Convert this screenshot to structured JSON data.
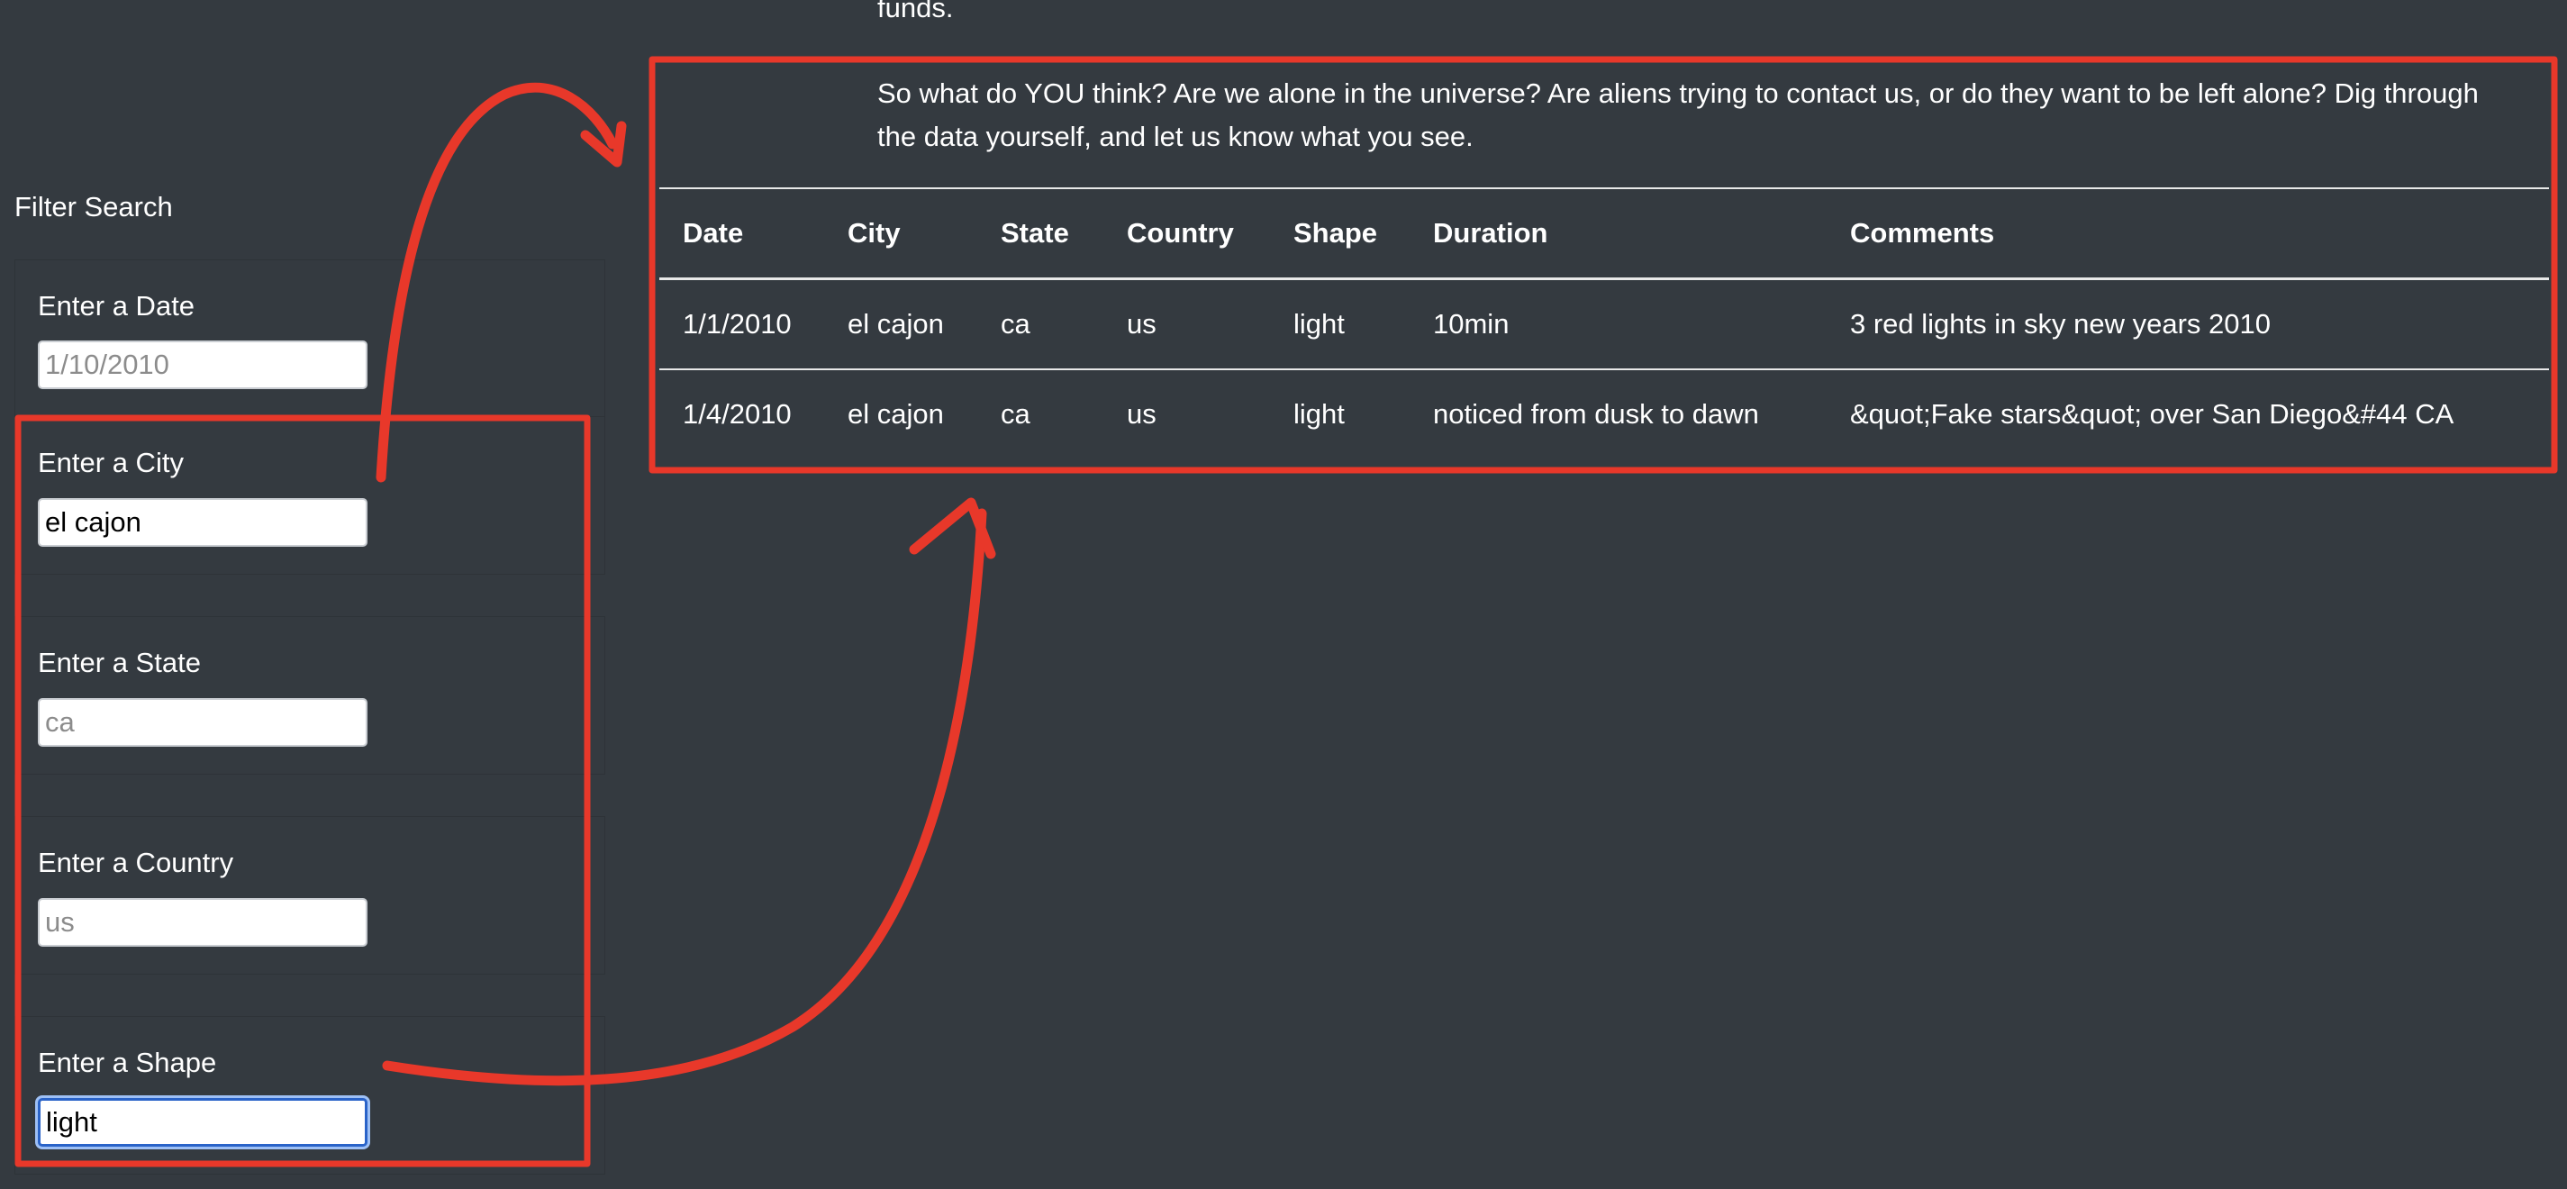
{
  "intro": {
    "tail": "funds.",
    "question": "So what do YOU think? Are we alone in the universe? Are aliens trying to contact us, or do they want to be left alone? Dig through the data yourself, and let us know what you see."
  },
  "filters": {
    "title": "Filter Search",
    "date": {
      "label": "Enter a Date",
      "placeholder": "1/10/2010",
      "value": ""
    },
    "city": {
      "label": "Enter a City",
      "placeholder": "",
      "value": "el cajon"
    },
    "state": {
      "label": "Enter a State",
      "placeholder": "ca",
      "value": ""
    },
    "country": {
      "label": "Enter a Country",
      "placeholder": "us",
      "value": ""
    },
    "shape": {
      "label": "Enter a Shape",
      "placeholder": "",
      "value": "light"
    }
  },
  "table": {
    "headers": [
      "Date",
      "City",
      "State",
      "Country",
      "Shape",
      "Duration",
      "Comments"
    ],
    "rows": [
      [
        "1/1/2010",
        "el cajon",
        "ca",
        "us",
        "light",
        "10min",
        "3 red lights in sky new years 2010"
      ],
      [
        "1/4/2010",
        "el cajon",
        "ca",
        "us",
        "light",
        "noticed from dusk to dawn",
        "&quot;Fake stars&quot; over San Diego&#44 CA"
      ]
    ]
  },
  "colors": {
    "background": "#343a40",
    "annotation": "#e8382a",
    "focus_ring": "#2a63c8"
  }
}
